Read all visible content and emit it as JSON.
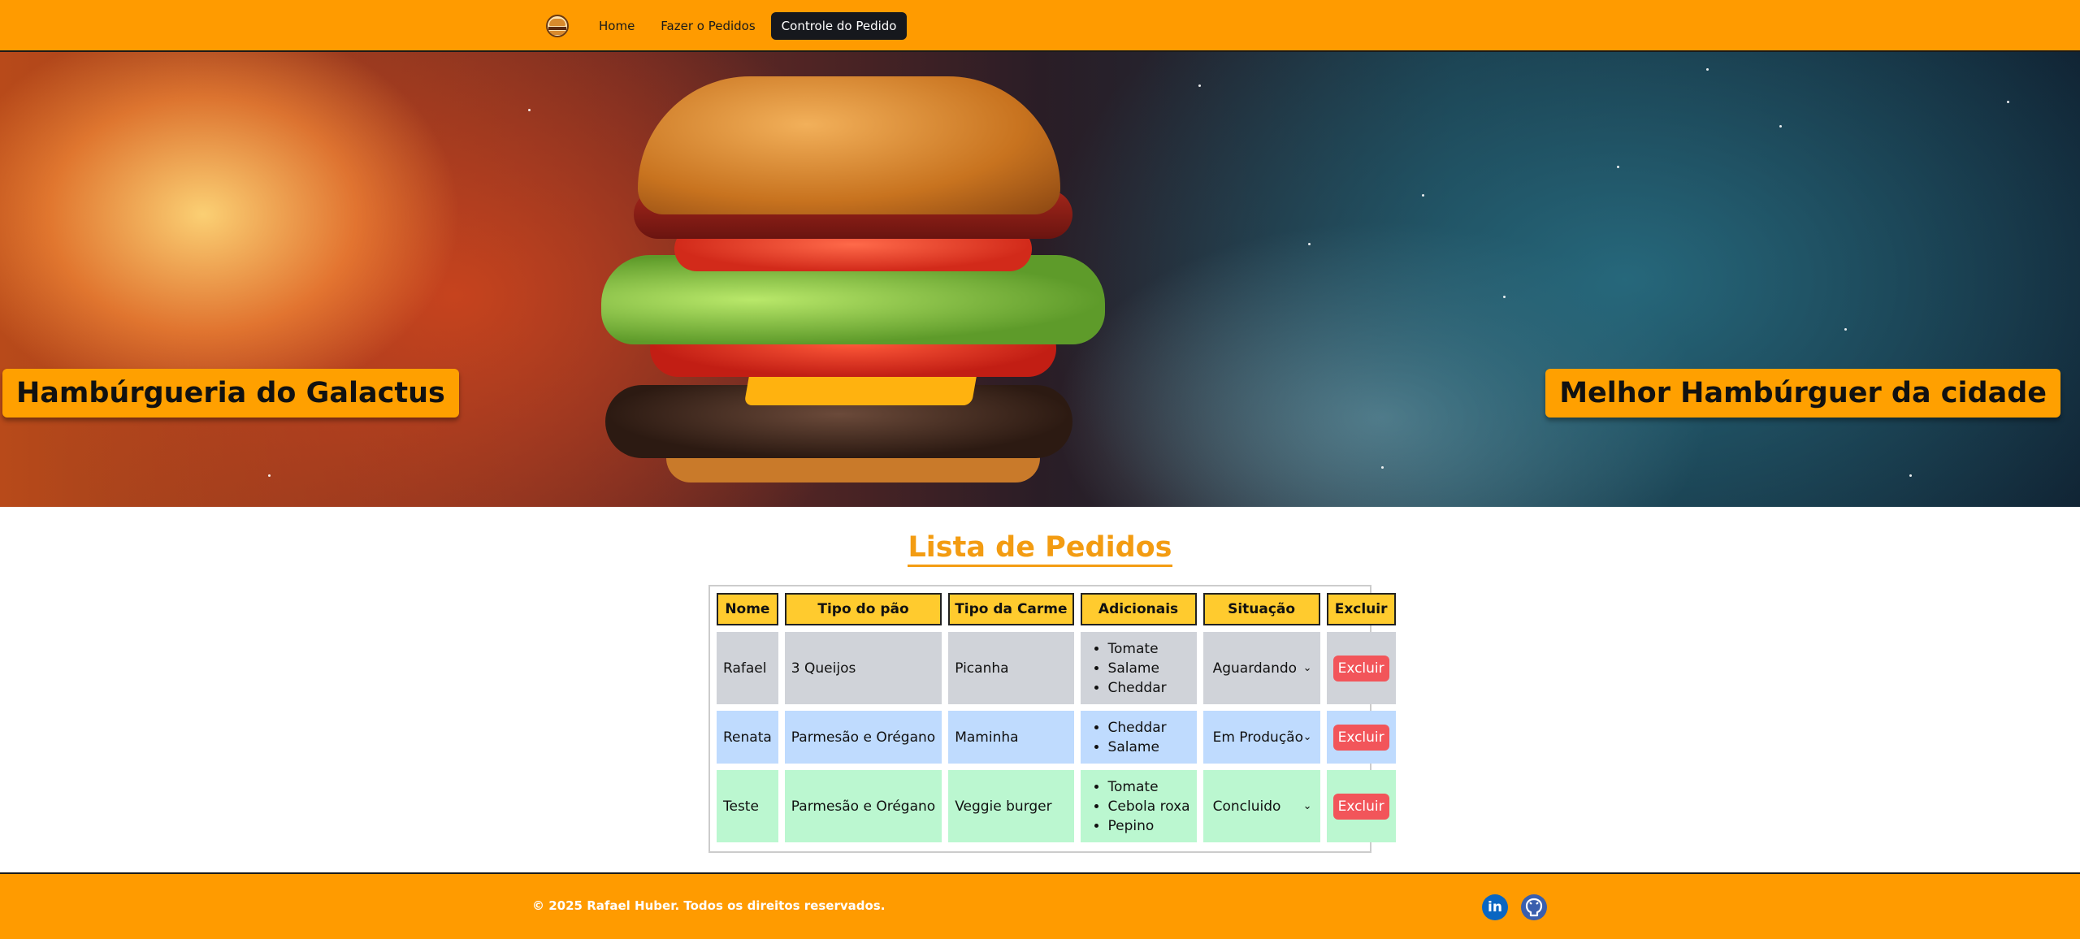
{
  "nav": {
    "logo_icon": "burger-logo-icon",
    "links": [
      {
        "label": "Home"
      },
      {
        "label": "Fazer o Pedidos"
      },
      {
        "label": "Controle do Pedido"
      }
    ]
  },
  "hero": {
    "left_title": "Hambúrgueria do Galactus",
    "right_title": "Melhor Hambúrguer da cidade"
  },
  "main": {
    "title": "Lista de Pedidos",
    "table": {
      "headers": [
        "Nome",
        "Tipo do pão",
        "Tipo da Carme",
        "Adicionais",
        "Situação",
        "Excluir"
      ],
      "rows": [
        {
          "nome": "Rafael",
          "pao": "3 Queijos",
          "carne": "Picanha",
          "adicionais": [
            "Tomate",
            "Salame",
            "Cheddar"
          ],
          "situacao": "Aguardando",
          "excluir": "Excluir"
        },
        {
          "nome": "Renata",
          "pao": "Parmesão e Orégano",
          "carne": "Maminha",
          "adicionais": [
            "Cheddar",
            "Salame"
          ],
          "situacao": "Em Produção",
          "excluir": "Excluir"
        },
        {
          "nome": "Teste",
          "pao": "Parmesão e Orégano",
          "carne": "Veggie burger",
          "adicionais": [
            "Tomate",
            "Cebola roxa",
            "Pepino"
          ],
          "situacao": "Concluido",
          "excluir": "Excluir"
        }
      ]
    }
  },
  "footer": {
    "copyright": "© 2025 Rafael Huber. Todos os direitos reservados.",
    "social_icons": [
      "linkedin-icon",
      "github-icon"
    ]
  },
  "colors": {
    "accent": "#ff9b00",
    "title": "#f39c12",
    "header_cell": "#ffcb2e",
    "row_waiting": "#d0d3d9",
    "row_production": "#bfdbfe",
    "row_done": "#bbf7d0",
    "delete_button": "#f2555a"
  }
}
